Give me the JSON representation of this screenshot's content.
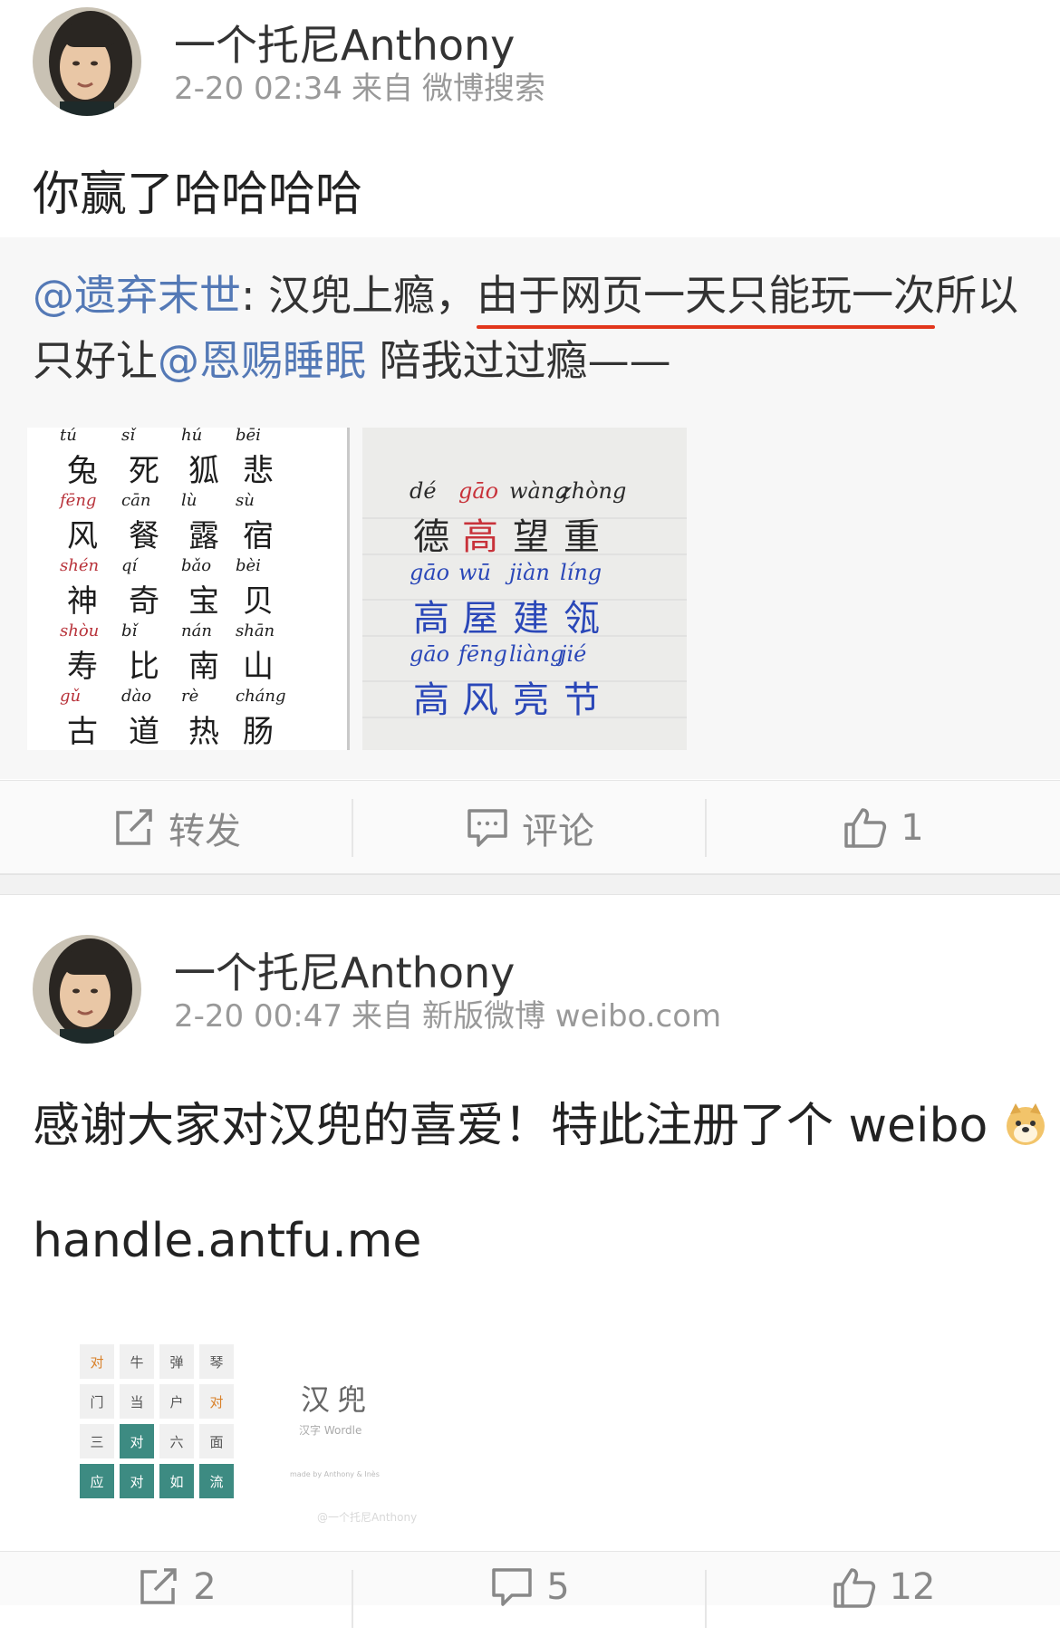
{
  "post1": {
    "username": "一个托尼Anthony",
    "time": "2-20 02:34",
    "from_label": "来自",
    "source": "微博搜索",
    "text": "你赢了哈哈哈哈",
    "quote": {
      "mention1": "@遗弃末世",
      "text_a": ": 汉兜上瘾，",
      "text_underlined": "由于网页一天只能玩一次",
      "text_b": "所以只好让",
      "mention2": "@恩赐睡眠",
      "text_c": " 陪我过过瘾——"
    },
    "image1": {
      "columns": [
        {
          "py": [
            "tú",
            "fēng",
            "shén",
            "shòu",
            "gǔ"
          ],
          "hz": [
            "兔",
            "风",
            "神",
            "寿",
            "古"
          ]
        },
        {
          "py": [
            "sǐ",
            "cān",
            "qí",
            "bǐ",
            "dào"
          ],
          "hz": [
            "死",
            "餐",
            "奇",
            "比",
            "道"
          ]
        },
        {
          "py": [
            "hú",
            "lù",
            "bǎo",
            "nán",
            "rè"
          ],
          "hz": [
            "狐",
            "露",
            "宝",
            "南",
            "热"
          ]
        },
        {
          "py": [
            "bēi",
            "sù",
            "bèi",
            "shān",
            "cháng"
          ],
          "hz": [
            "悲",
            "宿",
            "贝",
            "山",
            "肠"
          ]
        }
      ]
    },
    "image2": {
      "rows": [
        {
          "py": [
            "dé",
            "gāo",
            "wàng",
            "zhòng"
          ],
          "hz": [
            "德",
            "高",
            "望",
            "重"
          ]
        },
        {
          "py": [
            "gāo",
            "wū",
            "jiàn",
            "líng"
          ],
          "hz": [
            "高",
            "屋",
            "建",
            "瓴"
          ]
        },
        {
          "py": [
            "gāo",
            "fēng",
            "liàng",
            "jié"
          ],
          "hz": [
            "高",
            "风",
            "亮",
            "节"
          ]
        }
      ]
    },
    "actions": {
      "repost": "转发",
      "comment": "评论",
      "like_count": "1"
    }
  },
  "post2": {
    "username": "一个托尼Anthony",
    "time": "2-20 00:47",
    "from_label": "来自",
    "source": "新版微博 weibo.com",
    "text1": "感谢大家对汉兜的喜爱！特此注册了个 weibo",
    "text2": "handle.antfu.me",
    "grid": [
      [
        "对",
        "牛",
        "弹",
        "琴"
      ],
      [
        "门",
        "当",
        "户",
        "对"
      ],
      [
        "三",
        "对",
        "六",
        "面"
      ],
      [
        "应",
        "对",
        "如",
        "流"
      ]
    ],
    "logo_title": "汉兜",
    "logo_sub": "汉字 Wordle",
    "credit": "made by Anthony & Inès",
    "watermark": "@一个托尼Anthony",
    "actions": {
      "repost_count": "2",
      "comment_count": "5",
      "like_count": "12"
    }
  },
  "colors": {
    "mention": "#5479b6",
    "underline": "#e2361c",
    "tile_green": "#3d8b82",
    "tile_orange": "#d9822b"
  }
}
